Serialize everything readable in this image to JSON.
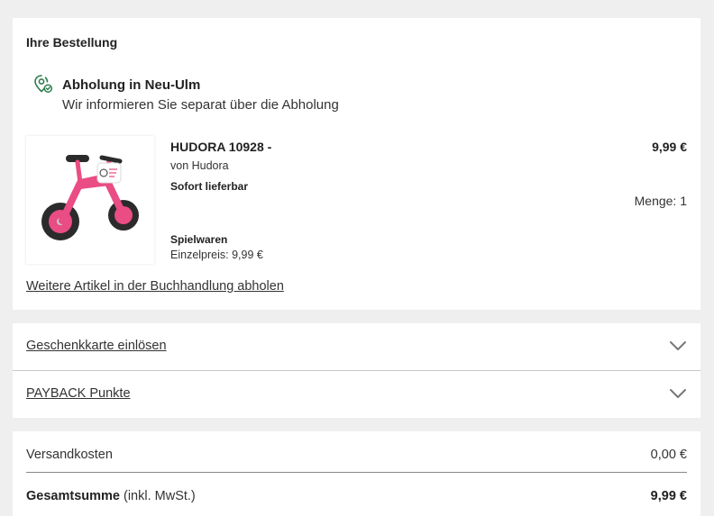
{
  "order": {
    "title": "Ihre Bestellung",
    "pickup": {
      "icon": "map-pin-check-icon",
      "title": "Abholung in Neu-Ulm",
      "subtitle": "Wir informieren Sie separat über die Abholung"
    },
    "item": {
      "name": "HUDORA 10928 -",
      "brand": "von Hudora",
      "availability": "Sofort lieferbar",
      "category": "Spielwaren",
      "unit_price": "Einzelpreis: 9,99 €",
      "price": "9,99 €",
      "quantity": "Menge: 1",
      "image": "pink-balance-bike-image"
    },
    "more_link": "Weitere Artikel in der Buchhandlung abholen"
  },
  "actions": {
    "giftcard_label": "Geschenkkarte einlösen",
    "payback_label": "PAYBACK Punkte"
  },
  "summary": {
    "shipping_label": "Versandkosten",
    "shipping_value": "0,00 €",
    "total_label": "Gesamtsumme",
    "total_suffix": " (inkl. MwSt.)",
    "total_value": "9,99 €"
  },
  "colors": {
    "background": "#efefef",
    "card": "#ffffff",
    "icon_green": "#2e7d4f",
    "bike_pink": "#ea4c84"
  }
}
